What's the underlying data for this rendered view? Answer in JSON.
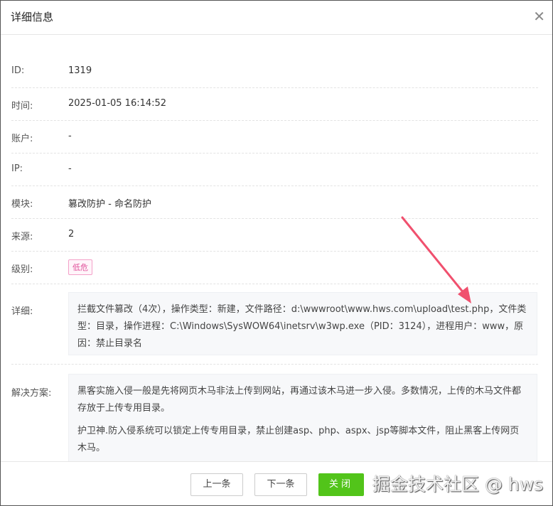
{
  "dialog": {
    "title": "详细信息"
  },
  "fields": [
    {
      "label": "ID:",
      "value": "1319"
    },
    {
      "label": "时间:",
      "value": "2025-01-05 16:14:52"
    },
    {
      "label": "账户:",
      "value": "-"
    },
    {
      "label": "IP:",
      "value": "-"
    },
    {
      "label": "模块:",
      "value": "篡改防护 - 命名防护"
    },
    {
      "label": "来源:",
      "value": "2"
    },
    {
      "label": "级别:",
      "value": "低危"
    }
  ],
  "detail": {
    "label": "详细:",
    "text": "拦截文件篡改（4次），操作类型：新建，文件路径：d:\\wwwroot\\www.hws.com\\upload\\test.php，文件类型：目录，操作进程：C:\\Windows\\SysWOW64\\inetsrv\\w3wp.exe（PID：3124），进程用户：www，原因：禁止目录名"
  },
  "solution": {
    "label": "解决方案:",
    "paragraphs": [
      "黑客实施入侵一般是先将网页木马非法上传到网站，再通过该木马进一步入侵。多数情况，上传的木马文件都存放于上传专用目录。",
      "护卫神.防入侵系统可以锁定上传专用目录，禁止创建asp、php、aspx、jsp等脚本文件，阻止黑客上传网页木马。"
    ]
  },
  "footer": {
    "prev": "上一条",
    "next": "下一条",
    "close": "关闭"
  },
  "watermark": "掘金技术社区 @ hws",
  "colors": {
    "accent": "#52c41a",
    "badge": "#e0509a",
    "arrow": "#f0506e"
  }
}
